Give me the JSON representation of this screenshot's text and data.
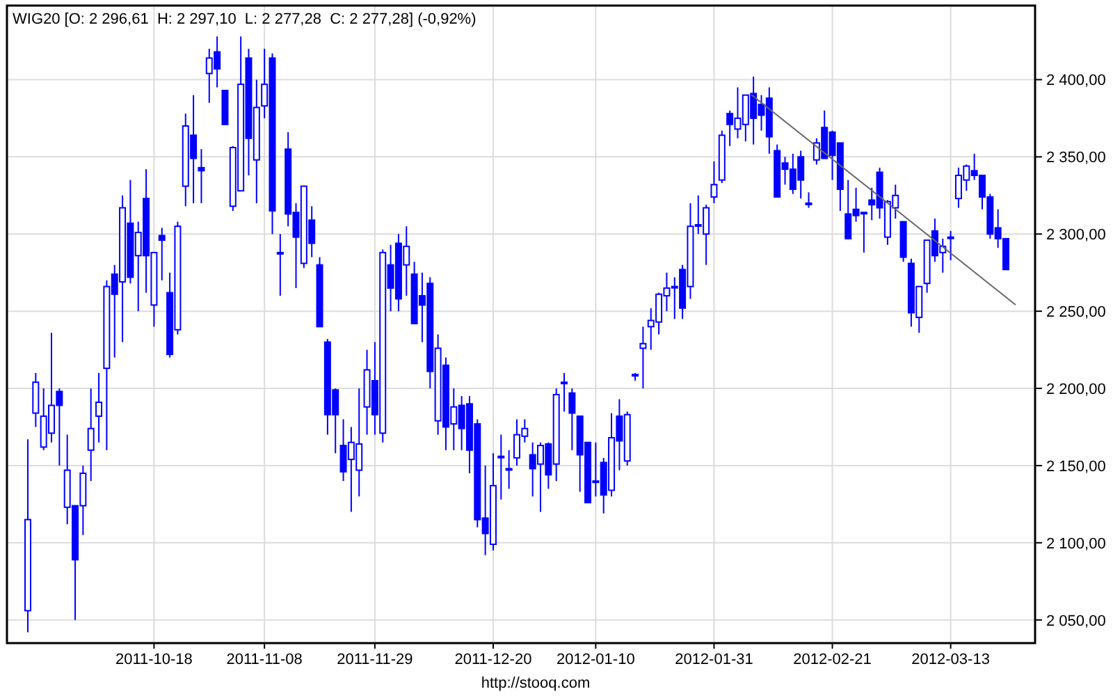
{
  "chart": {
    "chart_data": {
      "type": "candlestick",
      "title": "WIG20 [O: 2 296,61  H: 2 297,10  L: 2 277,28  C: 2 277,28] (-0,92%)",
      "grid": true,
      "ylim": [
        2035,
        2448
      ],
      "categories": [
        null,
        null,
        null,
        null,
        null,
        null,
        null,
        null,
        null,
        null,
        null,
        null,
        null,
        null,
        null,
        null,
        "2011-10-18",
        null,
        null,
        null,
        null,
        null,
        null,
        null,
        null,
        null,
        null,
        null,
        null,
        null,
        "2011-11-08",
        null,
        null,
        null,
        null,
        null,
        null,
        null,
        null,
        null,
        null,
        null,
        null,
        null,
        "2011-11-29",
        null,
        null,
        null,
        null,
        null,
        null,
        null,
        null,
        null,
        null,
        null,
        null,
        null,
        null,
        "2011-12-20",
        null,
        null,
        null,
        null,
        null,
        null,
        null,
        null,
        null,
        null,
        null,
        null,
        "2012-01-10",
        null,
        null,
        null,
        null,
        null,
        null,
        null,
        null,
        null,
        null,
        null,
        null,
        null,
        null,
        "2012-01-31",
        null,
        null,
        null,
        null,
        null,
        null,
        null,
        null,
        null,
        null,
        null,
        null,
        null,
        null,
        "2012-02-21",
        null,
        null,
        null,
        null,
        null,
        null,
        null,
        null,
        null,
        null,
        null,
        null,
        null,
        null,
        "2012-03-13",
        null,
        null,
        null,
        null,
        null,
        null,
        null
      ],
      "yticks": [
        {
          "value": 2050,
          "label": "2 050,00"
        },
        {
          "value": 2100,
          "label": "2 100,00"
        },
        {
          "value": 2150,
          "label": "2 150,00"
        },
        {
          "value": 2200,
          "label": "2 200,00"
        },
        {
          "value": 2250,
          "label": "2 250,00"
        },
        {
          "value": 2300,
          "label": "2 300,00"
        },
        {
          "value": 2350,
          "label": "2 350,00"
        },
        {
          "value": 2400,
          "label": "2 400,00"
        }
      ],
      "ohlc": [
        [
          2056,
          2167,
          2042,
          2115
        ],
        [
          2184,
          2210,
          2175,
          2204
        ],
        [
          2162,
          2200,
          2160,
          2182
        ],
        [
          2171,
          2236,
          2165,
          2189
        ],
        [
          2198,
          2200,
          2150,
          2189
        ],
        [
          2123,
          2170,
          2112,
          2147
        ],
        [
          2124,
          2124,
          2050,
          2089
        ],
        [
          2124,
          2150,
          2105,
          2145
        ],
        [
          2160,
          2200,
          2140,
          2174
        ],
        [
          2182,
          2210,
          2165,
          2191
        ],
        [
          2213,
          2270,
          2160,
          2266
        ],
        [
          2274,
          2280,
          2220,
          2261
        ],
        [
          2269,
          2325,
          2230,
          2317
        ],
        [
          2307,
          2335,
          2268,
          2272
        ],
        [
          2286,
          2308,
          2250,
          2301
        ],
        [
          2323,
          2342,
          2262,
          2286
        ],
        [
          2254,
          2288,
          2240,
          2288
        ],
        [
          2299,
          2304,
          2270,
          2296
        ],
        [
          2262,
          2275,
          2220,
          2222
        ],
        [
          2238,
          2308,
          2235,
          2305
        ],
        [
          2331,
          2378,
          2318,
          2370
        ],
        [
          2364,
          2390,
          2320,
          2349
        ],
        [
          2343,
          2355,
          2320,
          2341
        ],
        [
          2404,
          2420,
          2385,
          2414
        ],
        [
          2418,
          2428,
          2395,
          2407
        ],
        [
          2393,
          2393,
          2371,
          2371
        ],
        [
          2318,
          2357,
          2315,
          2356
        ],
        [
          2328,
          2428,
          2328,
          2397
        ],
        [
          2414,
          2420,
          2338,
          2362
        ],
        [
          2348,
          2400,
          2320,
          2382
        ],
        [
          2383,
          2420,
          2375,
          2397
        ],
        [
          2414,
          2417,
          2300,
          2315
        ],
        [
          2288,
          2300,
          2260,
          2288
        ],
        [
          2355,
          2366,
          2305,
          2313
        ],
        [
          2314,
          2320,
          2265,
          2298
        ],
        [
          2281,
          2331,
          2278,
          2331
        ],
        [
          2309,
          2318,
          2285,
          2294
        ],
        [
          2280,
          2285,
          2240,
          2240
        ],
        [
          2230,
          2232,
          2170,
          2183
        ],
        [
          2199,
          2200,
          2158,
          2183
        ],
        [
          2163,
          2180,
          2140,
          2146
        ],
        [
          2154,
          2175,
          2120,
          2165
        ],
        [
          2147,
          2200,
          2130,
          2164
        ],
        [
          2188,
          2225,
          2170,
          2212
        ],
        [
          2205,
          2230,
          2170,
          2183
        ],
        [
          2171,
          2290,
          2165,
          2288
        ],
        [
          2280,
          2293,
          2250,
          2265
        ],
        [
          2294,
          2300,
          2250,
          2258
        ],
        [
          2280,
          2305,
          2260,
          2292
        ],
        [
          2274,
          2282,
          2242,
          2242
        ],
        [
          2260,
          2275,
          2230,
          2254
        ],
        [
          2268,
          2272,
          2200,
          2211
        ],
        [
          2179,
          2235,
          2170,
          2226
        ],
        [
          2215,
          2220,
          2160,
          2175
        ],
        [
          2177,
          2200,
          2160,
          2188
        ],
        [
          2189,
          2195,
          2160,
          2174
        ],
        [
          2190,
          2195,
          2145,
          2160
        ],
        [
          2177,
          2180,
          2110,
          2115
        ],
        [
          2116,
          2150,
          2092,
          2106
        ],
        [
          2099,
          2158,
          2095,
          2137
        ],
        [
          2156,
          2170,
          2128,
          2156
        ],
        [
          2148,
          2160,
          2135,
          2148
        ],
        [
          2155,
          2180,
          2150,
          2170
        ],
        [
          2169,
          2180,
          2165,
          2174
        ],
        [
          2157,
          2165,
          2130,
          2148
        ],
        [
          2151,
          2165,
          2120,
          2163
        ],
        [
          2164,
          2165,
          2135,
          2144
        ],
        [
          2151,
          2200,
          2140,
          2196
        ],
        [
          2204,
          2210,
          2185,
          2204
        ],
        [
          2197,
          2200,
          2160,
          2184
        ],
        [
          2182,
          2182,
          2133,
          2157
        ],
        [
          2165,
          2165,
          2126,
          2126
        ],
        [
          2140,
          2165,
          2130,
          2140
        ],
        [
          2152,
          2155,
          2119,
          2131
        ],
        [
          2134,
          2184,
          2130,
          2168
        ],
        [
          2182,
          2193,
          2147,
          2166
        ],
        [
          2153,
          2185,
          2150,
          2183
        ],
        [
          2209,
          2210,
          2205,
          2209
        ],
        [
          2226,
          2240,
          2200,
          2229
        ],
        [
          2240,
          2252,
          2225,
          2244
        ],
        [
          2243,
          2262,
          2235,
          2261
        ],
        [
          2260,
          2275,
          2250,
          2265
        ],
        [
          2266,
          2272,
          2245,
          2266
        ],
        [
          2277,
          2280,
          2245,
          2252
        ],
        [
          2266,
          2320,
          2258,
          2305
        ],
        [
          2306,
          2325,
          2300,
          2306
        ],
        [
          2300,
          2319,
          2280,
          2317
        ],
        [
          2324,
          2347,
          2320,
          2332
        ],
        [
          2335,
          2367,
          2333,
          2364
        ],
        [
          2378,
          2380,
          2357,
          2371
        ],
        [
          2368,
          2395,
          2362,
          2375
        ],
        [
          2371,
          2390,
          2360,
          2390
        ],
        [
          2391,
          2402,
          2358,
          2375
        ],
        [
          2384,
          2390,
          2367,
          2377
        ],
        [
          2388,
          2395,
          2352,
          2363
        ],
        [
          2354,
          2358,
          2324,
          2324
        ],
        [
          2346,
          2350,
          2332,
          2342
        ],
        [
          2342,
          2352,
          2326,
          2329
        ],
        [
          2350,
          2354,
          2323,
          2335
        ],
        [
          2320,
          2327,
          2317,
          2320
        ],
        [
          2348,
          2362,
          2345,
          2359
        ],
        [
          2369,
          2380,
          2349,
          2349
        ],
        [
          2366,
          2367,
          2335,
          2351
        ],
        [
          2359,
          2359,
          2315,
          2329
        ],
        [
          2313,
          2335,
          2297,
          2297
        ],
        [
          2316,
          2330,
          2308,
          2312
        ],
        [
          2314,
          2314,
          2288,
          2314
        ],
        [
          2322,
          2330,
          2309,
          2319
        ],
        [
          2340,
          2343,
          2310,
          2317
        ],
        [
          2298,
          2322,
          2293,
          2321
        ],
        [
          2317,
          2332,
          2310,
          2325
        ],
        [
          2308,
          2308,
          2282,
          2285
        ],
        [
          2281,
          2284,
          2240,
          2249
        ],
        [
          2246,
          2266,
          2236,
          2266
        ],
        [
          2268,
          2296,
          2262,
          2296
        ],
        [
          2302,
          2310,
          2282,
          2286
        ],
        [
          2288,
          2297,
          2275,
          2292
        ],
        [
          2298,
          2302,
          2283,
          2298
        ],
        [
          2323,
          2343,
          2317,
          2338
        ],
        [
          2335,
          2345,
          2328,
          2344
        ],
        [
          2341,
          2352,
          2335,
          2338
        ],
        [
          2338,
          2338,
          2316,
          2324
        ],
        [
          2324,
          2326,
          2297,
          2300
        ],
        [
          2304,
          2316,
          2291,
          2297
        ],
        [
          2297,
          2297,
          2277,
          2277
        ]
      ]
    }
  },
  "footer": {
    "link": "http://stooq.com"
  }
}
